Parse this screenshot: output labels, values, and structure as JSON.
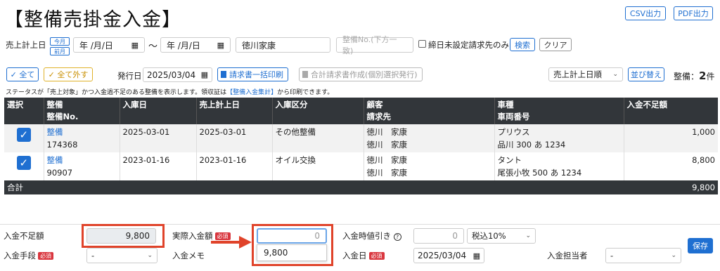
{
  "page_title": "【整備売掛金入金】",
  "header": {
    "csv_label": "CSV出力",
    "pdf_label": "PDF出力"
  },
  "filter": {
    "sales_date_label": "売上計上日",
    "today_label": "今月",
    "prev_month_label": "前月",
    "date_from": "年 /月/日",
    "tilde": "〜",
    "date_to": "年 /月/日",
    "customer_value": "徳川家康",
    "maintenance_no_placeholder": "整備No.(下方一致)",
    "unset_billing_label": "締日未設定請求先のみ",
    "search_label": "検索",
    "clear_label": "クリア"
  },
  "toolbar": {
    "select_all_label": "✓ 全て",
    "deselect_all_label": "✓ 全て外す",
    "issue_date_label": "発行日",
    "issue_date_value": "2025/03/04",
    "bulk_print_label": "請求書一括印刷",
    "combined_invoice_label": "合計請求書作成(個別選択発行)",
    "sort_value": "売上計上日順",
    "sort_button_label": "並び替え",
    "count_label": "整備：",
    "count_value": "2",
    "count_unit": "件"
  },
  "status_note": {
    "prefix": "ステータスが「売上対象」かつ入金過不足のある整備を表示します。領収証は",
    "link": "【整備入金集計】",
    "suffix": "から印刷できます。"
  },
  "table": {
    "headers": [
      {
        "l1": "選択",
        "l2": ""
      },
      {
        "l1": "整備",
        "l2": "整備No."
      },
      {
        "l1": "入庫日",
        "l2": ""
      },
      {
        "l1": "売上計上日",
        "l2": ""
      },
      {
        "l1": "入庫区分",
        "l2": ""
      },
      {
        "l1": "顧客",
        "l2": "請求先"
      },
      {
        "l1": "車種",
        "l2": "車両番号"
      },
      {
        "l1": "入金不足額",
        "l2": ""
      }
    ],
    "rows": [
      {
        "link": "整備",
        "no": "174368",
        "in_date": "2025-03-01",
        "sales_date": "2025-03-01",
        "category": "その他整備",
        "customer": "徳川　家康",
        "billing": "徳川　家康",
        "model": "プリウス",
        "plate": "品川 300 あ 1234",
        "shortage": "1,000"
      },
      {
        "link": "整備",
        "no": "90907",
        "in_date": "2023-01-16",
        "sales_date": "2023-01-16",
        "category": "オイル交換",
        "customer": "徳川　家康",
        "billing": "徳川　家康",
        "model": "タント",
        "plate": "尾張小牧 500 あ 1234",
        "shortage": "8,800"
      }
    ],
    "total_label": "合計",
    "total_value": "9,800"
  },
  "form": {
    "shortage_label": "入金不足額",
    "shortage_value": "9,800",
    "actual_label": "実際入金額",
    "required": "必須",
    "actual_value": "0",
    "suggestion": "9,800",
    "discount_label": "入金時値引き",
    "discount_value": "0",
    "tax_value": "税込10%",
    "method_label": "入金手段",
    "method_value": "-",
    "memo_label": "入金メモ",
    "date_label": "入金日",
    "date_value": "2025/03/04",
    "staff_label": "入金担当者",
    "staff_value": "-",
    "save_label": "保存"
  }
}
